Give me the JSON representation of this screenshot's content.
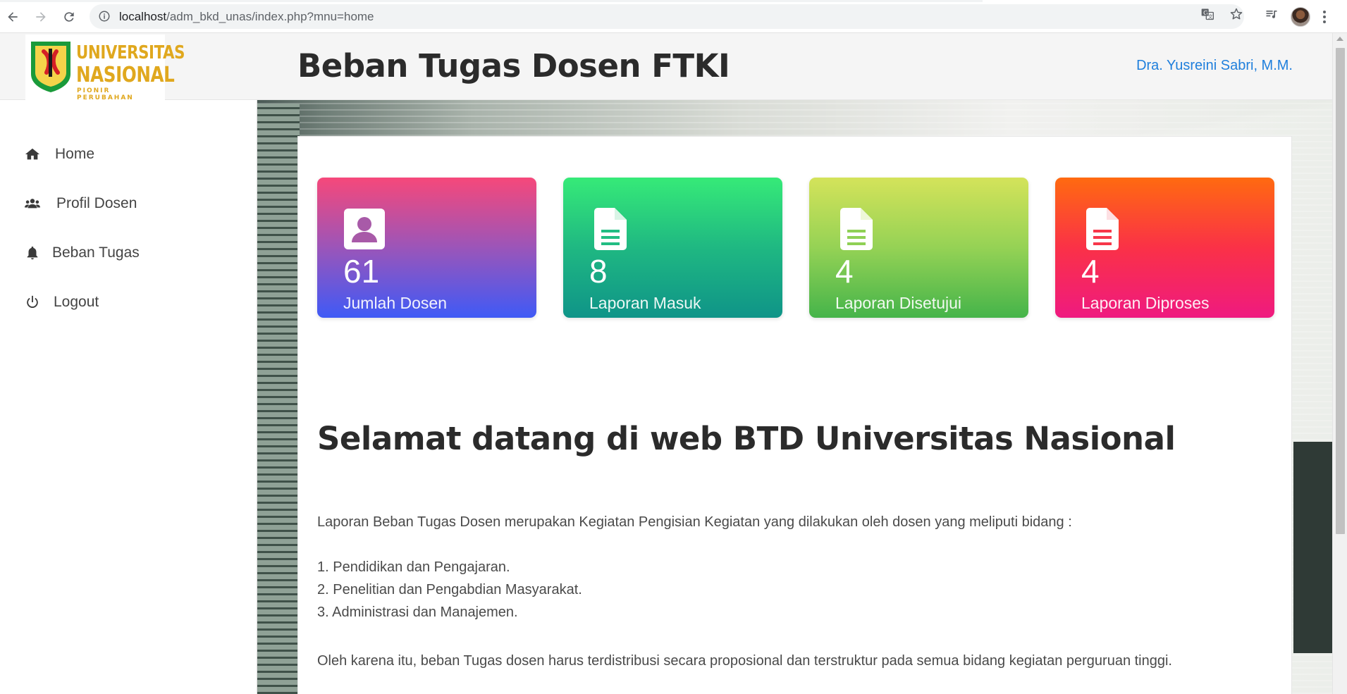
{
  "browser": {
    "url_host": "localhost",
    "url_path": "/adm_bkd_unas/index.php?mnu=home",
    "icons": [
      "back-arrow-icon",
      "forward-arrow-icon",
      "reload-icon",
      "info-icon",
      "translate-icon",
      "star-icon",
      "media-queue-icon",
      "profile-avatar",
      "menu-kebab-icon"
    ]
  },
  "logo": {
    "line1": "UNIVERSITAS",
    "line2": "NASIONAL",
    "tagline": "PIONIR PERUBAHAN"
  },
  "header": {
    "title": "Beban Tugas Dosen FTKI",
    "user": "Dra. Yusreini Sabri, M.M."
  },
  "sidebar": {
    "items": [
      {
        "label": "Home",
        "icon": "home-icon"
      },
      {
        "label": "Profil Dosen",
        "icon": "users-icon"
      },
      {
        "label": "Beban Tugas",
        "icon": "bell-icon"
      },
      {
        "label": "Logout",
        "icon": "power-icon"
      }
    ]
  },
  "stats": [
    {
      "value": "61",
      "label": "Jumlah Dosen",
      "icon": "user-card-icon",
      "accent": "#9b55b9"
    },
    {
      "value": "8",
      "label": "Laporan Masuk",
      "icon": "document-icon",
      "accent": "#1fb882"
    },
    {
      "value": "4",
      "label": "Laporan Disetujui",
      "icon": "document-icon",
      "accent": "#95d255"
    },
    {
      "value": "4",
      "label": "Laporan Diproses",
      "icon": "document-icon",
      "accent": "#fa3147"
    }
  ],
  "content": {
    "welcome": "Selamat datang di web BTD Universitas Nasional",
    "intro": "Laporan Beban Tugas Dosen merupakan Kegiatan Pengisian Kegiatan yang dilakukan oleh dosen yang meliputi bidang :",
    "list": [
      "1. Pendidikan dan Pengajaran.",
      "2. Penelitian dan Pengabdian Masyarakat.",
      "3. Administrasi dan Manajemen."
    ],
    "closing": "Oleh karena itu, beban Tugas dosen harus terdistribusi secara proposional dan terstruktur pada semua bidang kegiatan perguruan tinggi."
  },
  "colors": {
    "user_link": "#1f7fdc",
    "logo_gold": "#e0a81e"
  }
}
